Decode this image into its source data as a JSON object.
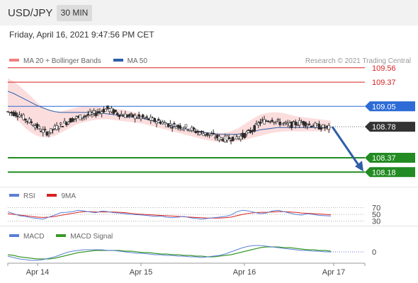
{
  "header": {
    "symbol": "USD/JPY",
    "timeframe": "30 MIN"
  },
  "datetime": "Friday, April 16, 2021 9:47:56 PM CET",
  "credit": "Research © 2021 Trading Central",
  "legend_main": {
    "bb": {
      "label": "MA 20 + Bollinger Bands",
      "color": "#f08080"
    },
    "ma50": {
      "label": "MA 50",
      "color": "#2e5ea8"
    }
  },
  "legend_rsi": {
    "rsi": {
      "label": "RSI",
      "color": "#5b7fd6"
    },
    "ma9": {
      "label": "9MA",
      "color": "#d82020"
    }
  },
  "legend_macd": {
    "macd": {
      "label": "MACD",
      "color": "#5b7fd6"
    },
    "signal": {
      "label": "MACD Signal",
      "color": "#3a9a2a"
    }
  },
  "colors": {
    "resistance": "#d82020",
    "pivot": "#2d6bd6",
    "support": "#228b22",
    "last": "#333333",
    "arrow": "#2e5ea8",
    "bands": "#fbd7d7",
    "candle": "#2a2a2a"
  },
  "chart_data": {
    "type": "candlestick",
    "price_range": [
      107.93,
      109.82
    ],
    "x_ticks": [
      "Apr 14",
      "Apr 15",
      "Apr 16",
      "Apr 17"
    ],
    "levels": [
      {
        "value": 109.56,
        "label": "109.56",
        "kind": "resistance"
      },
      {
        "value": 109.37,
        "label": "109.37",
        "kind": "resistance"
      },
      {
        "value": 109.05,
        "label": "109.05",
        "kind": "pivot"
      },
      {
        "value": 108.78,
        "label": "108.78",
        "kind": "last"
      },
      {
        "value": 108.37,
        "label": "108.37",
        "kind": "support"
      },
      {
        "value": 108.18,
        "label": "108.18",
        "kind": "support"
      }
    ],
    "forecast": {
      "from": 108.78,
      "to": 108.18
    },
    "close": [
      108.98,
      108.96,
      108.94,
      108.88,
      108.84,
      108.78,
      108.72,
      108.7,
      108.76,
      108.8,
      108.84,
      108.88,
      108.9,
      108.92,
      108.94,
      108.96,
      108.99,
      109.02,
      108.98,
      108.95,
      108.93,
      108.92,
      108.91,
      108.9,
      108.88,
      108.86,
      108.85,
      108.82,
      108.8,
      108.79,
      108.78,
      108.76,
      108.72,
      108.7,
      108.68,
      108.66,
      108.63,
      108.62,
      108.63,
      108.64,
      108.66,
      108.7,
      108.76,
      108.84,
      108.86,
      108.88,
      108.84,
      108.82,
      108.8,
      108.82,
      108.84,
      108.82,
      108.8,
      108.78,
      108.77,
      108.76
    ],
    "ma20_band_upper": [
      109.42,
      109.38,
      109.32,
      109.25,
      109.18,
      109.1,
      109.04,
      109.0,
      108.98,
      108.98,
      109.0,
      109.02,
      109.04,
      109.05,
      109.05,
      109.05,
      109.04,
      109.03,
      109.02,
      109.01,
      109.0,
      108.98,
      108.96,
      108.93,
      108.9,
      108.87,
      108.84,
      108.82,
      108.8,
      108.78,
      108.77,
      108.76,
      108.74,
      108.72,
      108.71,
      108.7,
      108.7,
      108.7,
      108.72,
      108.75,
      108.8,
      108.85,
      108.9,
      108.94,
      108.96,
      108.97,
      108.97,
      108.96,
      108.94,
      108.92,
      108.91,
      108.9,
      108.89,
      108.88,
      108.87,
      108.86
    ],
    "ma20_band_lower": [
      109.0,
      108.92,
      108.84,
      108.76,
      108.7,
      108.66,
      108.64,
      108.64,
      108.66,
      108.7,
      108.74,
      108.78,
      108.82,
      108.84,
      108.86,
      108.87,
      108.88,
      108.88,
      108.87,
      108.86,
      108.85,
      108.84,
      108.83,
      108.82,
      108.8,
      108.78,
      108.76,
      108.74,
      108.72,
      108.7,
      108.68,
      108.66,
      108.64,
      108.62,
      108.6,
      108.59,
      108.58,
      108.58,
      108.58,
      108.59,
      108.6,
      108.62,
      108.64,
      108.66,
      108.68,
      108.7,
      108.71,
      108.72,
      108.72,
      108.72,
      108.72,
      108.72,
      108.72,
      108.72,
      108.72,
      108.72
    ],
    "ma50": [
      109.25,
      109.22,
      109.18,
      109.14,
      109.1,
      109.06,
      109.03,
      109.0,
      108.98,
      108.97,
      108.97,
      108.97,
      108.97,
      108.97,
      108.97,
      108.96,
      108.96,
      108.95,
      108.94,
      108.93,
      108.92,
      108.91,
      108.9,
      108.89,
      108.87,
      108.85,
      108.83,
      108.81,
      108.79,
      108.77,
      108.76,
      108.74,
      108.72,
      108.71,
      108.7,
      108.69,
      108.68,
      108.68,
      108.68,
      108.68,
      108.69,
      108.7,
      108.72,
      108.74,
      108.75,
      108.76,
      108.77,
      108.77,
      108.77,
      108.77,
      108.77,
      108.77,
      108.77,
      108.77,
      108.77,
      108.77
    ],
    "rsi": {
      "levels": [
        70,
        50,
        30
      ],
      "rsi": [
        58,
        52,
        46,
        44,
        40,
        38,
        36,
        42,
        48,
        55,
        56,
        58,
        62,
        60,
        57,
        55,
        60,
        58,
        55,
        54,
        52,
        50,
        49,
        48,
        46,
        44,
        45,
        42,
        40,
        42,
        44,
        40,
        38,
        36,
        38,
        40,
        42,
        44,
        48,
        58,
        62,
        60,
        56,
        52,
        54,
        60,
        62,
        58,
        54,
        50,
        48,
        52,
        50,
        47,
        46,
        45
      ],
      "ma9": [
        52,
        50,
        48,
        46,
        44,
        42,
        41,
        42,
        44,
        47,
        50,
        53,
        56,
        58,
        58,
        57,
        57,
        57,
        57,
        56,
        55,
        53,
        51,
        50,
        49,
        48,
        47,
        46,
        45,
        44,
        43,
        42,
        41,
        40,
        39,
        39,
        39,
        40,
        42,
        46,
        50,
        53,
        55,
        56,
        56,
        57,
        58,
        58,
        57,
        56,
        54,
        53,
        52,
        51,
        50,
        49
      ]
    },
    "macd": {
      "zero_label": "0",
      "macd": [
        -0.06,
        -0.08,
        -0.1,
        -0.11,
        -0.12,
        -0.12,
        -0.11,
        -0.09,
        -0.07,
        -0.04,
        -0.01,
        0.01,
        0.02,
        0.03,
        0.03,
        0.03,
        0.03,
        0.02,
        0.02,
        0.01,
        0.0,
        -0.01,
        -0.02,
        -0.02,
        -0.03,
        -0.04,
        -0.04,
        -0.05,
        -0.05,
        -0.06,
        -0.06,
        -0.07,
        -0.07,
        -0.08,
        -0.07,
        -0.06,
        -0.05,
        -0.03,
        0.0,
        0.03,
        0.06,
        0.08,
        0.09,
        0.09,
        0.08,
        0.07,
        0.06,
        0.05,
        0.04,
        0.03,
        0.02,
        0.02,
        0.01,
        0.01,
        0.0,
        0.0
      ],
      "signal": [
        -0.04,
        -0.05,
        -0.07,
        -0.08,
        -0.09,
        -0.1,
        -0.1,
        -0.1,
        -0.09,
        -0.07,
        -0.05,
        -0.03,
        -0.01,
        0.0,
        0.01,
        0.02,
        0.02,
        0.02,
        0.02,
        0.02,
        0.01,
        0.01,
        0.0,
        -0.01,
        -0.01,
        -0.02,
        -0.03,
        -0.03,
        -0.04,
        -0.04,
        -0.05,
        -0.05,
        -0.06,
        -0.06,
        -0.07,
        -0.07,
        -0.06,
        -0.05,
        -0.04,
        -0.02,
        0.0,
        0.02,
        0.04,
        0.06,
        0.07,
        0.07,
        0.07,
        0.06,
        0.06,
        0.05,
        0.04,
        0.03,
        0.03,
        0.02,
        0.02,
        0.01
      ]
    }
  }
}
